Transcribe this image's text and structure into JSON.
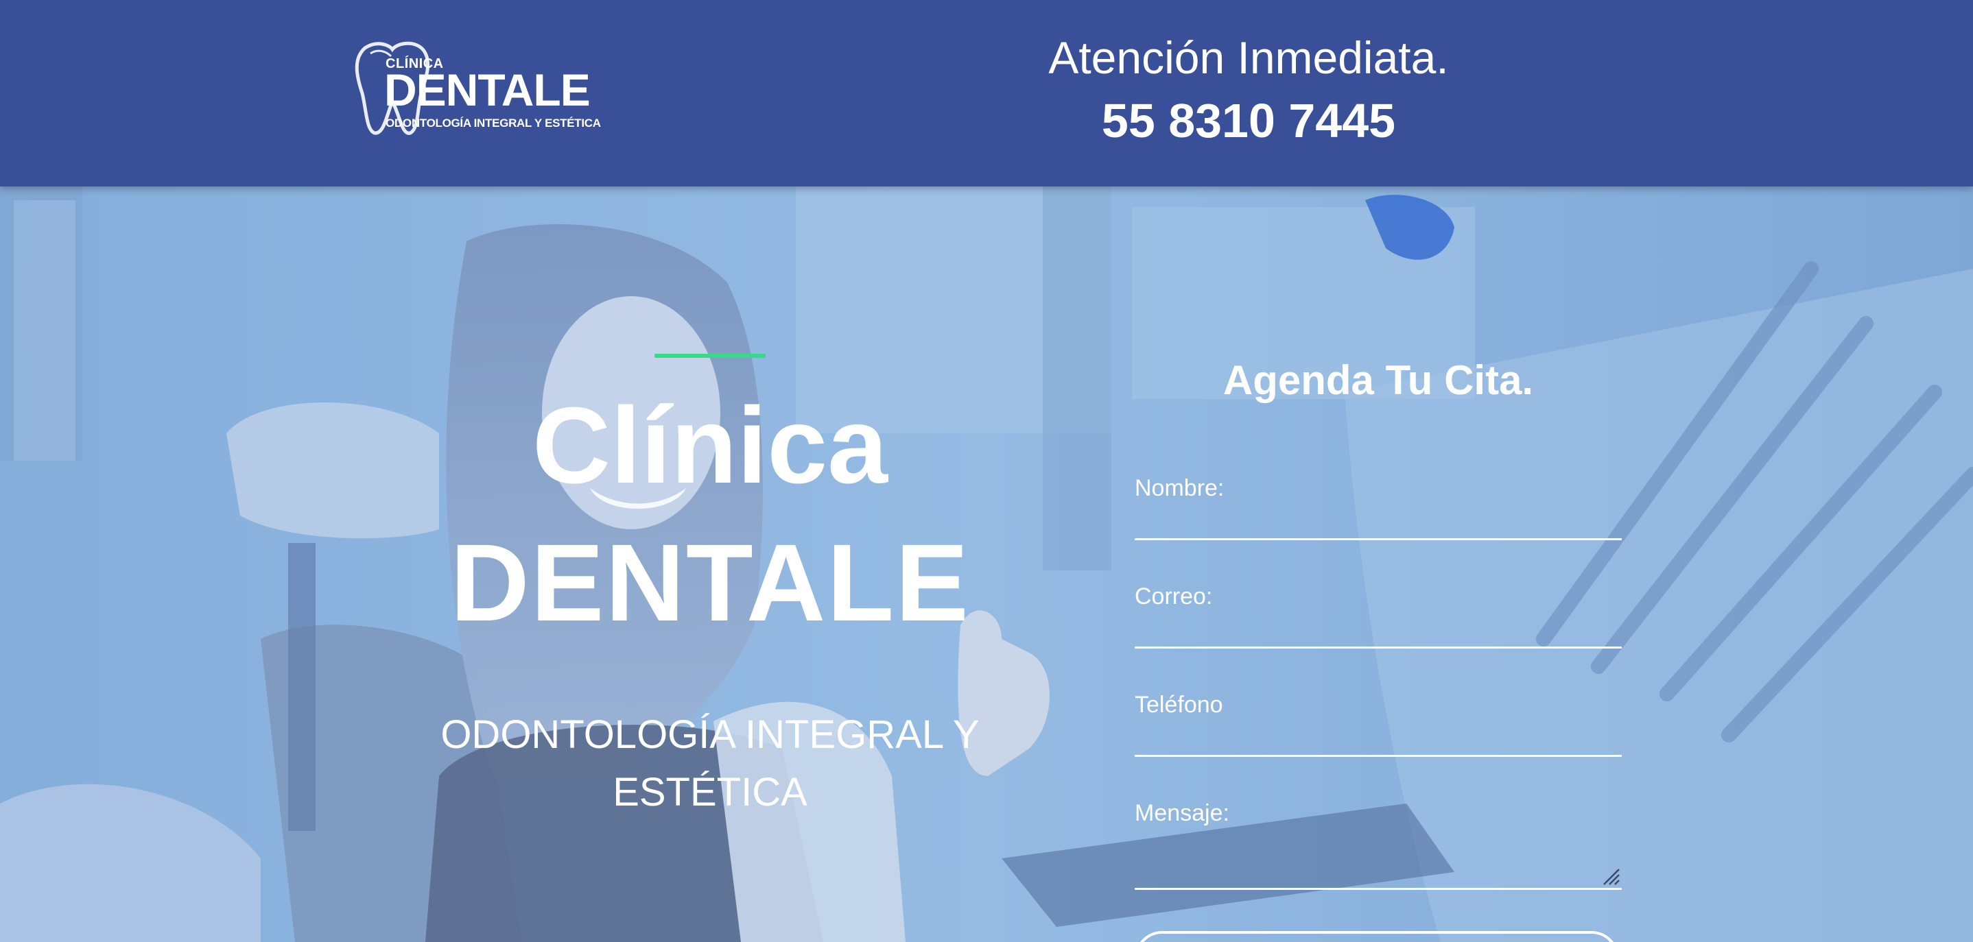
{
  "header": {
    "logo": {
      "small": "CLÍNICA",
      "name": "DENTALE",
      "tagline": "ODONTOLOGÍA INTEGRAL Y ESTÉTICA"
    },
    "attention": "Atención Inmediata.",
    "phone": "55 8310 7445",
    "bg_color": "#394f98"
  },
  "hero": {
    "title_line1": "Clínica",
    "title_line2": "DENTALE",
    "subtitle": "ODONTOLOGÍA INTEGRAL Y ESTÉTICA",
    "accent_color": "#39d98a",
    "overlay_color": "#7fa9d8"
  },
  "form": {
    "title": "Agenda Tu Cita.",
    "fields": [
      {
        "label": "Nombre:",
        "value": ""
      },
      {
        "label": "Correo:",
        "value": ""
      },
      {
        "label": "Teléfono",
        "value": ""
      },
      {
        "label": "Mensaje:",
        "value": ""
      }
    ],
    "submit_label": ""
  },
  "icons": {
    "logo": "tooth-logo-icon",
    "resize": "resize-grip-icon"
  }
}
